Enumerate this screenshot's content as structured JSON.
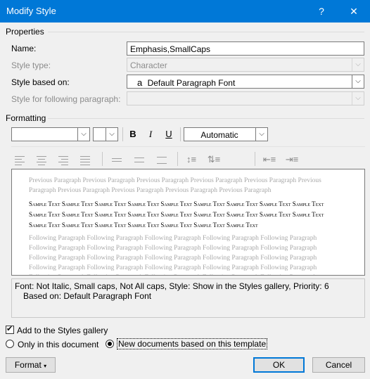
{
  "window": {
    "title": "Modify Style",
    "help_glyph": "?",
    "close_glyph": "✕"
  },
  "properties": {
    "heading": "Properties",
    "name_label": "Name:",
    "name_value": "Emphasis,SmallCaps",
    "style_type_label": "Style type:",
    "style_type_value": "Character",
    "based_on_label": "Style based on:",
    "based_on_glyph": "a",
    "based_on_value": "Default Paragraph Font",
    "following_label": "Style for following paragraph:",
    "following_value": ""
  },
  "formatting": {
    "heading": "Formatting",
    "font_value": "",
    "size_value": "",
    "bold": "B",
    "italic": "I",
    "underline": "U",
    "color_value": "Automatic"
  },
  "preview": {
    "previous_paragraph": "Previous Paragraph Previous Paragraph Previous Paragraph Previous Paragraph Previous Paragraph Previous Paragraph Previous Paragraph Previous Paragraph Previous Paragraph Previous Paragraph",
    "sample_text": "Sample Text Sample Text Sample Text Sample Text Sample Text Sample Text Sample Text Sample Text Sample Text Sample Text Sample Text Sample Text Sample Text Sample Text Sample Text Sample Text Sample Text Sample Text Sample Text Sample Text Sample Text Sample Text Sample Text Sample Text Sample Text",
    "following_paragraph": "Following Paragraph Following Paragraph Following Paragraph Following Paragraph Following Paragraph Following Paragraph Following Paragraph Following Paragraph Following Paragraph Following Paragraph Following Paragraph Following Paragraph Following Paragraph Following Paragraph Following Paragraph Following Paragraph Following Paragraph Following Paragraph Following Paragraph Following Paragraph Following Paragraph Following Paragraph Following Paragraph Following Paragraph Following Paragraph"
  },
  "description": {
    "line1": "Font: Not Italic, Small caps, Not All caps, Style: Show in the Styles gallery, Priority: 6",
    "line2": "Based on: Default Paragraph Font"
  },
  "options": {
    "add_to_gallery": "Add to the Styles gallery",
    "add_to_gallery_checked": true,
    "only_this_document": "Only in this document",
    "new_documents": "New documents based on this template",
    "selected_scope": "new_documents"
  },
  "buttons": {
    "format": "Format",
    "ok": "OK",
    "cancel": "Cancel"
  },
  "colors": {
    "titlebar": "#0078d7",
    "dialog_bg": "#f0f0f0",
    "disabled_text": "#8c8c8c"
  }
}
